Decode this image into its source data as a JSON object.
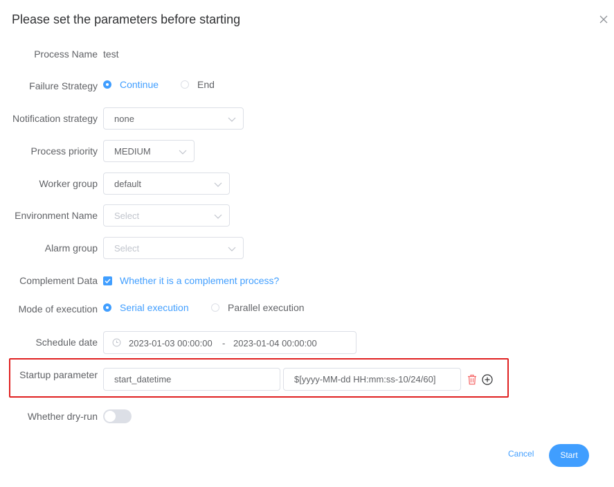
{
  "dialog": {
    "title": "Please set the parameters before starting"
  },
  "process_name": {
    "label": "Process Name",
    "value": "test"
  },
  "failure_strategy": {
    "label": "Failure Strategy",
    "options": [
      "Continue",
      "End"
    ],
    "selected": "Continue"
  },
  "notification_strategy": {
    "label": "Notification strategy",
    "value": "none"
  },
  "process_priority": {
    "label": "Process priority",
    "value": "MEDIUM"
  },
  "worker_group": {
    "label": "Worker group",
    "value": "default"
  },
  "environment_name": {
    "label": "Environment Name",
    "placeholder": "Select"
  },
  "alarm_group": {
    "label": "Alarm group",
    "placeholder": "Select"
  },
  "complement_data": {
    "label": "Complement Data",
    "checkbox_label": "Whether it is a complement process?",
    "checked": true
  },
  "mode_of_execution": {
    "label": "Mode of execution",
    "options": [
      "Serial execution",
      "Parallel execution"
    ],
    "selected": "Serial execution"
  },
  "schedule_date": {
    "label": "Schedule date",
    "start": "2023-01-03 00:00:00",
    "separator": "-",
    "end": "2023-01-04 00:00:00"
  },
  "startup_parameter": {
    "label": "Startup parameter",
    "key": "start_datetime",
    "value": "$[yyyy-MM-dd HH:mm:ss-10/24/60]"
  },
  "dry_run": {
    "label": "Whether dry-run",
    "on": false
  },
  "footer": {
    "cancel_label": "Cancel",
    "start_label": "Start"
  },
  "colors": {
    "primary": "#409eff",
    "highlight_border": "#e02020",
    "delete_icon": "#f56c6c"
  },
  "icons": {
    "close": "close-icon",
    "chevron": "chevron-down-icon",
    "clock": "clock-icon",
    "delete": "trash-icon",
    "add": "plus-circle-icon"
  }
}
